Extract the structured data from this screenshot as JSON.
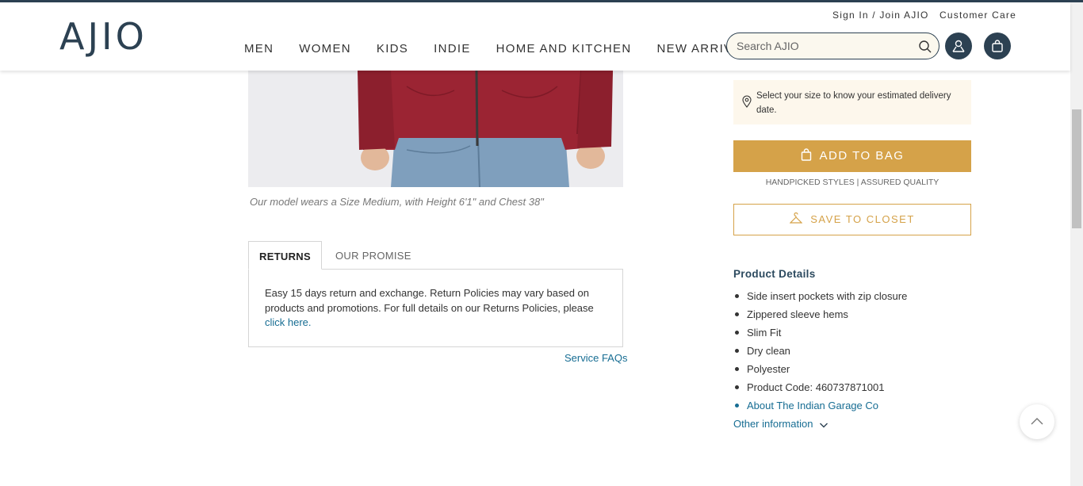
{
  "header": {
    "logo": "AJIO",
    "sign_in": "Sign In / Join AJIO",
    "customer_care": "Customer Care",
    "nav": [
      "MEN",
      "WOMEN",
      "KIDS",
      "INDIE",
      "HOME AND KITCHEN",
      "NEW ARRIVALS"
    ],
    "search_placeholder": "Search AJIO"
  },
  "product": {
    "model_caption": "Our model wears a Size Medium, with Height 6'1\" and Chest 38\""
  },
  "tabs": {
    "returns_label": "RETURNS",
    "promise_label": "OUR PROMISE",
    "returns_text": "Easy 15 days return and exchange. Return Policies may vary based on products and promotions. For full details on our Returns Policies, please ",
    "returns_link": "click here.",
    "service_faqs": "Service FAQs"
  },
  "purchase": {
    "delivery_note": "Select your size to know your estimated delivery date.",
    "add_to_bag": "ADD TO BAG",
    "handpicked": "HANDPICKED STYLES | ASSURED QUALITY",
    "save_to_closet": "SAVE TO CLOSET"
  },
  "details": {
    "title": "Product Details",
    "items": [
      "Side insert pockets with zip closure",
      "Zippered sleeve hems",
      "Slim Fit",
      "Dry clean",
      "Polyester",
      "Product Code: 460737871001"
    ],
    "brand_link": "About The Indian Garage Co",
    "other_info": "Other information"
  },
  "colors": {
    "brand_dark": "#2c4152",
    "gold": "#d5a249",
    "link": "#176d93",
    "jacket": "#9b2433",
    "denim": "#7f9fbd"
  },
  "icons": [
    "search-icon",
    "user-icon",
    "bag-icon",
    "location-pin-icon",
    "shopping-bag-icon",
    "hanger-icon",
    "chevron-down-icon",
    "chevron-up-icon"
  ]
}
